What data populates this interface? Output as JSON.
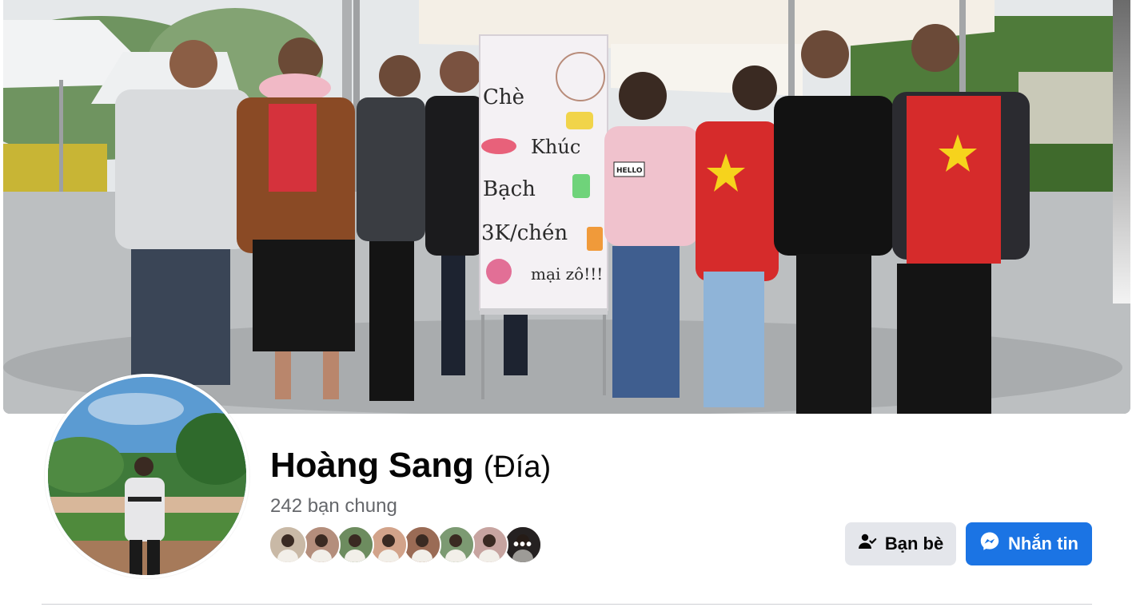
{
  "profile": {
    "name": "Hoàng Sang",
    "alternate_name": "(Đía)",
    "mutual_friends": "242 bạn chung"
  },
  "cover": {
    "sign_lines": [
      "Chè",
      "Khúc",
      "Bạch",
      "3K/chén",
      "mại zô!!!"
    ],
    "hello_tag": "HELLO"
  },
  "mutual_friend_avatars": [
    {
      "color": "#c9b9a6"
    },
    {
      "color": "#b48e7c"
    },
    {
      "color": "#6d8c5f"
    },
    {
      "color": "#d2a38a"
    },
    {
      "color": "#9a6b55"
    },
    {
      "color": "#7c9a72"
    },
    {
      "color": "#c7a4a0"
    },
    {
      "color": "#3a3433"
    }
  ],
  "actions": {
    "friends_label": "Bạn bè",
    "message_label": "Nhắn tin"
  },
  "colors": {
    "primary": "#1b74e4",
    "secondary_button": "#e4e6eb",
    "meta_text": "#65676b"
  }
}
